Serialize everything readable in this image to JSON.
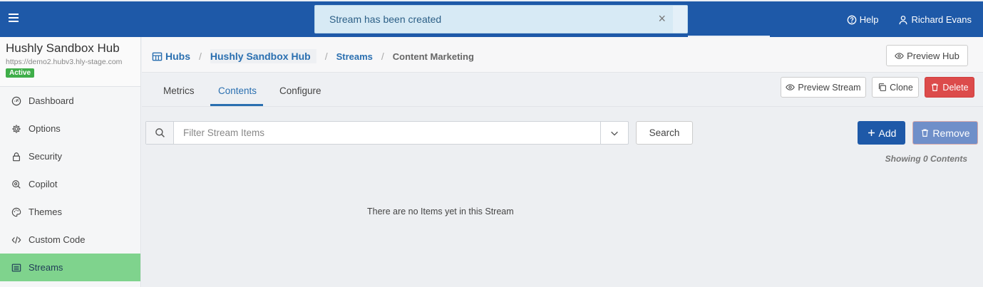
{
  "topbar": {
    "help_label": "Help",
    "user_name": "Richard Evans",
    "toast_message": "Stream has been created",
    "toast_close": "×"
  },
  "hub": {
    "name": "Hushly Sandbox Hub",
    "url": "https://demo2.hubv3.hly-stage.com",
    "status": "Active"
  },
  "sidebar": {
    "items": [
      {
        "label": "Dashboard",
        "icon": "dashboard-icon"
      },
      {
        "label": "Options",
        "icon": "gear-icon"
      },
      {
        "label": "Security",
        "icon": "lock-icon"
      },
      {
        "label": "Copilot",
        "icon": "copilot-icon"
      },
      {
        "label": "Themes",
        "icon": "palette-icon"
      },
      {
        "label": "Custom Code",
        "icon": "code-icon"
      },
      {
        "label": "Streams",
        "icon": "list-icon",
        "active": true
      }
    ]
  },
  "breadcrumb": {
    "hubs": "Hubs",
    "hub": "Hushly Sandbox Hub",
    "streams": "Streams",
    "current": "Content Marketing",
    "separator": "/"
  },
  "actions": {
    "preview_hub": "Preview Hub",
    "preview_stream": "Preview Stream",
    "clone": "Clone",
    "delete": "Delete"
  },
  "tabs": [
    {
      "label": "Metrics"
    },
    {
      "label": "Contents",
      "active": true
    },
    {
      "label": "Configure"
    }
  ],
  "content": {
    "search_placeholder": "Filter Stream Items",
    "search_button": "Search",
    "add_button": "Add",
    "remove_button": "Remove",
    "showing": "Showing 0 Contents",
    "empty_message": "There are no Items yet in this Stream"
  },
  "colors": {
    "brand_blue": "#1e59a8",
    "active_nav": "#7fd38d",
    "delete_red": "#dc4b4b",
    "add_blue": "#1e59a8",
    "remove_blue": "#6f8fc9",
    "badge_green": "#3fae49"
  }
}
